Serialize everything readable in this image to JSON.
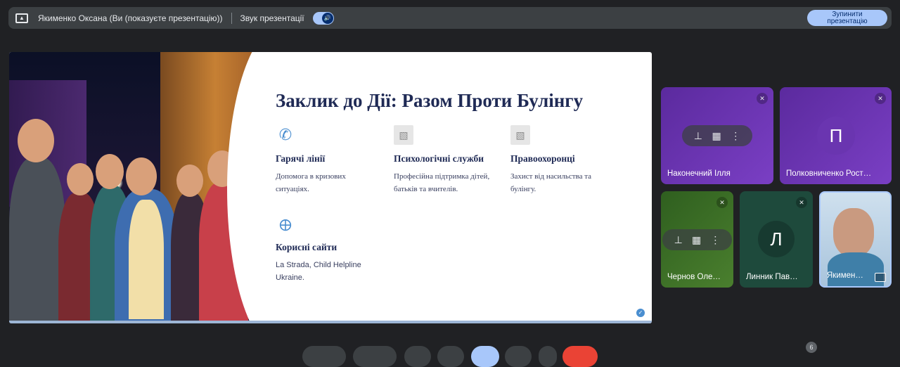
{
  "topbar": {
    "title": "Якименко Оксана (Ви (показуєте презентацію))",
    "sound_label": "Звук презентації",
    "stop_button": "Зупинити презентацію"
  },
  "slide": {
    "title": "Заклик до Дії: Разом Проти Булінгу",
    "cards": [
      {
        "icon": "phone-icon",
        "heading": "Гарячі лінії",
        "text": "Допомога в кризових ситуаціях."
      },
      {
        "icon": "image-placeholder-icon",
        "heading": "Психологічні служби",
        "text": "Професійна підтримка дітей, батьків та вчителів."
      },
      {
        "icon": "image-placeholder-icon",
        "heading": "Правоохоронці",
        "text": "Захист від насильства та булінгу."
      },
      {
        "icon": "globe-icon",
        "heading": "Корисні сайти",
        "text": "La Strada, Child Helpline Ukraine."
      }
    ]
  },
  "participants": [
    {
      "name": "Наконечний Ілля",
      "initial": "",
      "color": "#5b2a9e"
    },
    {
      "name": "Полковниченко Рост…",
      "initial": "П",
      "color": "#5b2a9e"
    },
    {
      "name": "Чернов Оле…",
      "initial": "",
      "color": "#2f5f1f"
    },
    {
      "name": "Линник Пав…",
      "initial": "Л",
      "color": "#1e4a3c"
    },
    {
      "name": "Якимен…",
      "initial": "",
      "color": "#8ab4d8"
    }
  ],
  "participant_count": "6",
  "colors": {
    "accent": "#a8c7fa",
    "background": "#202124",
    "slide_title": "#1f2a55"
  }
}
